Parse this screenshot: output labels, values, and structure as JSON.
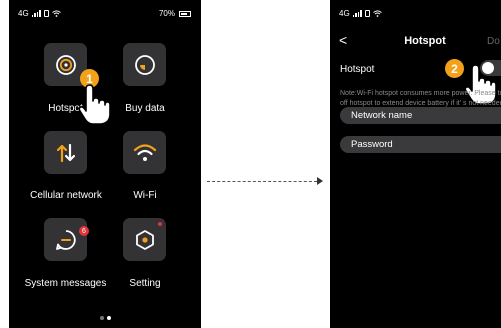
{
  "status_bar": {
    "network": "4G",
    "battery": "70%"
  },
  "home": {
    "tiles": [
      {
        "label": "Hotspot",
        "icon": "hotspot-icon"
      },
      {
        "label": "Buy data",
        "icon": "buy-data-icon"
      },
      {
        "label": "Cellular network",
        "icon": "cellular-network-icon"
      },
      {
        "label": "Wi-Fi",
        "icon": "wifi-icon"
      },
      {
        "label": "System messages",
        "icon": "system-messages-icon",
        "badge": "6"
      },
      {
        "label": "Setting",
        "icon": "setting-icon"
      }
    ],
    "step": "1",
    "page_dots": 2,
    "active_dot": 2
  },
  "hotspot_screen": {
    "back": "<",
    "title": "Hotspot",
    "done": "Do",
    "toggle_label": "Hotspot",
    "toggle_on": false,
    "step": "2",
    "note": "Note:Wi-Fi hotspot consumes more power. Please turn off hotspot to extend device battery if it' s not needed",
    "fields": [
      {
        "label": "Network name"
      },
      {
        "label": "Password"
      }
    ]
  },
  "colors": {
    "accent": "#f4a11a",
    "badge": "#e0333a",
    "tile": "#333335",
    "field": "#3a3a3c"
  }
}
